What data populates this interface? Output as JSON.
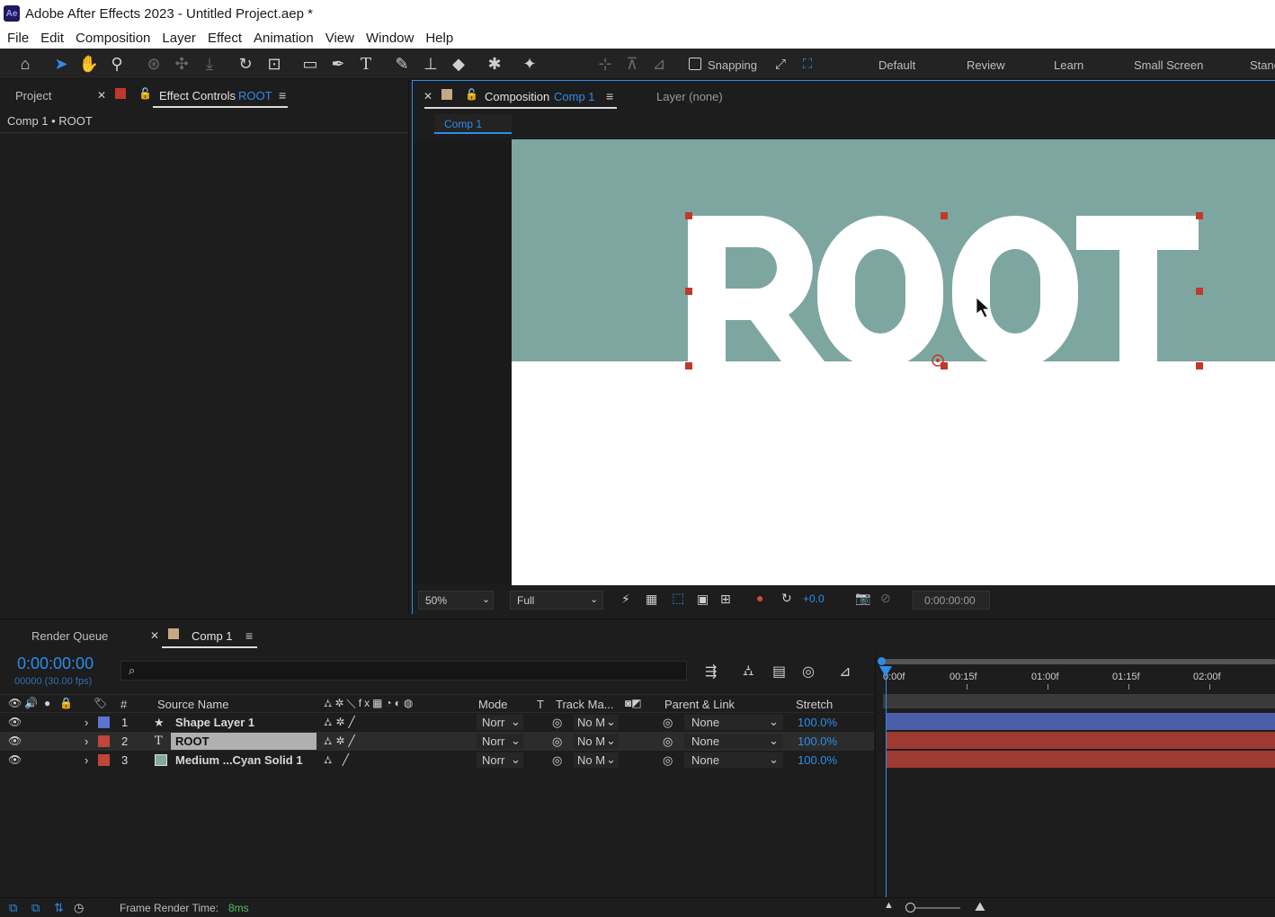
{
  "window": {
    "title": "Adobe After Effects 2023 - Untitled Project.aep *",
    "app_icon": "Ae"
  },
  "menu": [
    "File",
    "Edit",
    "Composition",
    "Layer",
    "Effect",
    "Animation",
    "View",
    "Window",
    "Help"
  ],
  "toolbar": {
    "snapping_label": "Snapping",
    "workspaces": [
      "Default",
      "Review",
      "Learn",
      "Small Screen",
      "Stanc"
    ]
  },
  "left_panel": {
    "tab_project": "Project",
    "tab_effect_controls": "Effect Controls",
    "effect_target": "ROOT",
    "breadcrumb": "Comp 1 • ROOT"
  },
  "comp_panel": {
    "tab_label": "Composition",
    "comp_name": "Comp 1",
    "layer_tab": "Layer (none)",
    "subtab": "Comp 1",
    "canvas_text": "ROOT",
    "zoom": "50%",
    "resolution": "Full",
    "exposure": "+0.0",
    "timecode": "0:00:00:00"
  },
  "colors": {
    "accent": "#2d8ceb",
    "comp_bg_teal": "#7ea6a0",
    "handle_red": "#c0392b",
    "shape_layer": "#5a74d0",
    "text_layer": "#c0453a",
    "solid_layer": "#80a9a0",
    "bar_blue": "#4a5ea8",
    "bar_red": "#9e3a32"
  },
  "timeline": {
    "tab_render_queue": "Render Queue",
    "tab_comp": "Comp 1",
    "current_time": "0:00:00:00",
    "frames_fps": "00000 (30.00 fps)",
    "search_icon": "search-icon",
    "columns": {
      "number": "#",
      "source_name": "Source Name",
      "mode": "Mode",
      "t": "T",
      "track_matte": "Track Ma...",
      "parent_link": "Parent & Link",
      "stretch": "Stretch"
    },
    "ruler": [
      "0:00f",
      "00:15f",
      "01:00f",
      "01:15f",
      "02:00f"
    ],
    "layers": [
      {
        "num": "1",
        "type_icon": "star",
        "name": "Shape Layer 1",
        "mode": "Norr",
        "matte": "No M",
        "parent": "None",
        "stretch": "100.0%"
      },
      {
        "num": "2",
        "type_icon": "T",
        "name": "ROOT",
        "mode": "Norr",
        "matte": "No M",
        "parent": "None",
        "stretch": "100.0%"
      },
      {
        "num": "3",
        "type_icon": "solid",
        "name": "Medium ...Cyan Solid 1",
        "mode": "Norr",
        "matte": "No M",
        "parent": "None",
        "stretch": "100.0%"
      }
    ],
    "status_label": "Frame Render Time:",
    "status_value": "8ms"
  }
}
